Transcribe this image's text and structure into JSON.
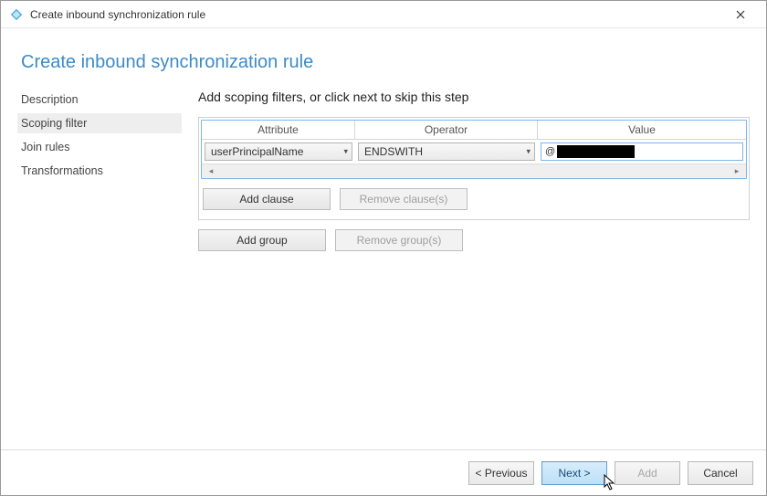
{
  "window": {
    "title": "Create inbound synchronization rule"
  },
  "page": {
    "heading": "Create inbound synchronization rule",
    "instruction": "Add scoping filters, or click next to skip this step"
  },
  "sidebar": {
    "items": [
      {
        "label": "Description"
      },
      {
        "label": "Scoping filter"
      },
      {
        "label": "Join rules"
      },
      {
        "label": "Transformations"
      }
    ],
    "selected_index": 1
  },
  "grid": {
    "headers": {
      "attribute": "Attribute",
      "operator": "Operator",
      "value": "Value"
    },
    "row": {
      "attribute": "userPrincipalName",
      "operator": "ENDSWITH",
      "value_prefix": "@",
      "value_redacted": true
    }
  },
  "clause_buttons": {
    "add": "Add clause",
    "remove": "Remove clause(s)"
  },
  "group_buttons": {
    "add": "Add group",
    "remove": "Remove group(s)"
  },
  "footer": {
    "previous": "< Previous",
    "next": "Next >",
    "add": "Add",
    "cancel": "Cancel"
  }
}
